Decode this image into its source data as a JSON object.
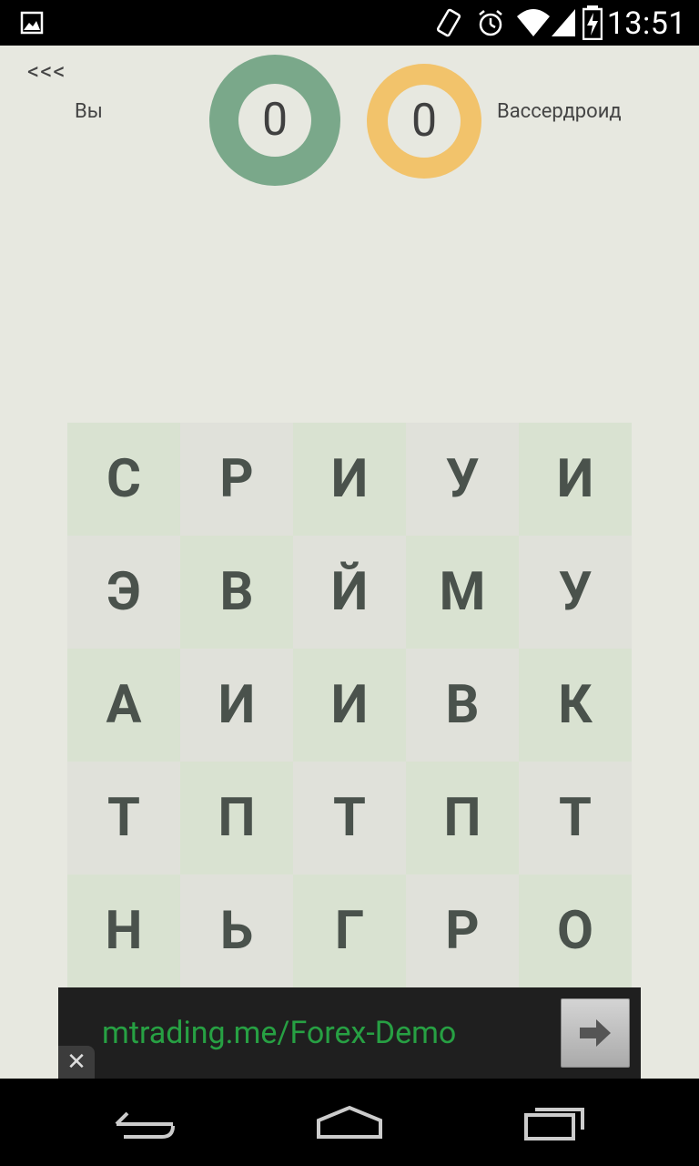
{
  "status_bar": {
    "time": "13:51",
    "icons": [
      "image-icon",
      "vibrate-icon",
      "alarm-icon",
      "wifi-icon",
      "signal-icon",
      "battery-charging-icon"
    ]
  },
  "header": {
    "back_label": "<<<",
    "player_label": "Вы",
    "opponent_label": "Вассердроид",
    "player_score": "0",
    "opponent_score": "0",
    "colors": {
      "player_ring": "#7aa88a",
      "opponent_ring": "#f2c36b"
    }
  },
  "board": {
    "rows": [
      [
        "С",
        "Р",
        "И",
        "У",
        "И"
      ],
      [
        "Э",
        "В",
        "Й",
        "М",
        "У"
      ],
      [
        "А",
        "И",
        "И",
        "В",
        "К"
      ],
      [
        "Т",
        "П",
        "Т",
        "П",
        "Т"
      ],
      [
        "Н",
        "Ь",
        "Г",
        "Р",
        "О"
      ]
    ]
  },
  "ad": {
    "text": "mtrading.me/Forex-Demo",
    "close_label": "✕",
    "button_icon": "arrow-right-icon"
  },
  "nav_bar": {
    "icons": [
      "back-icon",
      "home-icon",
      "recents-icon"
    ]
  }
}
